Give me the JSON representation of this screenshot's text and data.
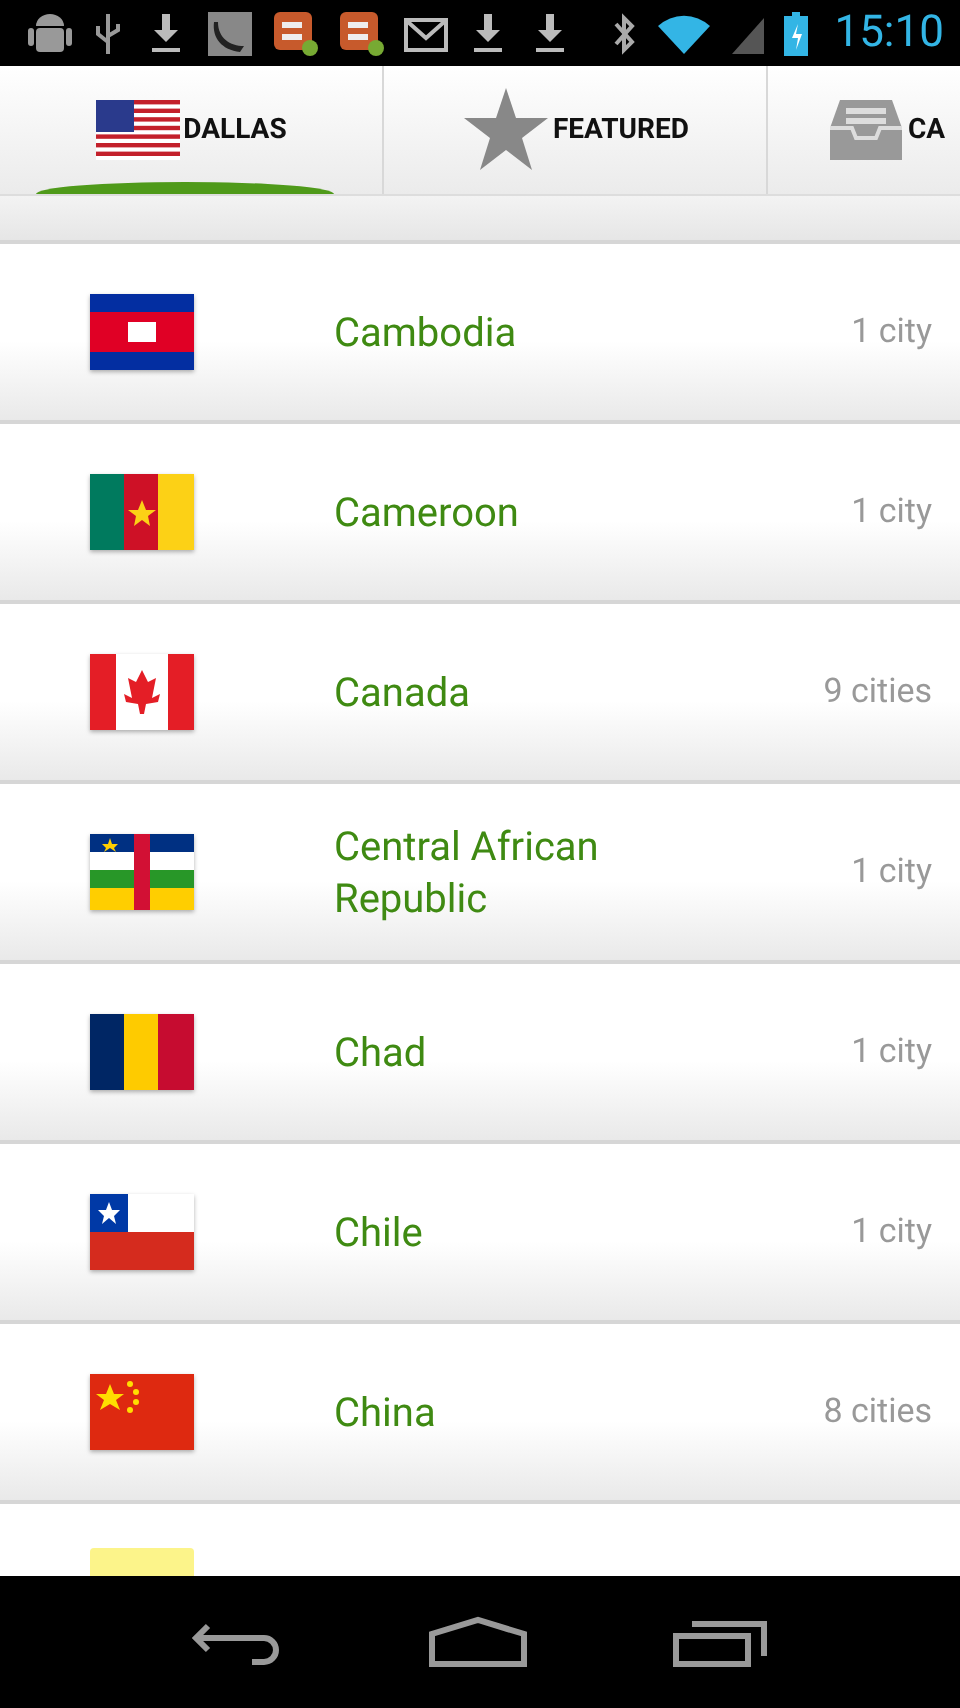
{
  "status_bar": {
    "time": "15:10"
  },
  "tabs": [
    {
      "label": "DALLAS",
      "selected": true
    },
    {
      "label": "FEATURED",
      "selected": false
    },
    {
      "label": "CA",
      "selected": false
    }
  ],
  "countries": [
    {
      "name": "Cambodia",
      "count": "1 city"
    },
    {
      "name": "Cameroon",
      "count": "1 city"
    },
    {
      "name": "Canada",
      "count": "9 cities"
    },
    {
      "name": "Central African Republic",
      "count": "1 city"
    },
    {
      "name": "Chad",
      "count": "1 city"
    },
    {
      "name": "Chile",
      "count": "1 city"
    },
    {
      "name": "China",
      "count": "8 cities"
    }
  ]
}
